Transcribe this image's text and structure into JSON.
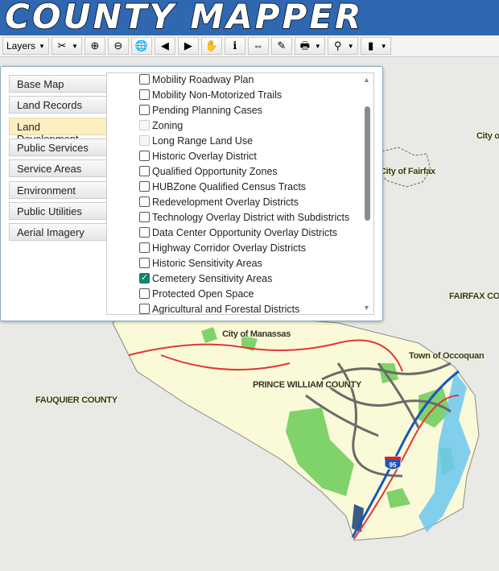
{
  "app": {
    "title": "COUNTY MAPPER"
  },
  "toolbar": {
    "layers_label": "Layers",
    "tools": [
      {
        "name": "tools-icon",
        "glyph": "✂"
      },
      {
        "name": "zoom-in-icon",
        "glyph": "⊕"
      },
      {
        "name": "zoom-out-icon",
        "glyph": "⊖"
      },
      {
        "name": "full-extent-globe-icon",
        "glyph": "🌐"
      },
      {
        "name": "previous-extent-icon",
        "glyph": "◀"
      },
      {
        "name": "next-extent-icon",
        "glyph": "▶"
      },
      {
        "name": "pan-hand-icon",
        "glyph": "✋"
      },
      {
        "name": "identify-info-icon",
        "glyph": "ℹ"
      },
      {
        "name": "measure-icon",
        "glyph": "⇔"
      },
      {
        "name": "draw-pencil-icon",
        "glyph": "✎"
      },
      {
        "name": "print-icon",
        "glyph": "🖶"
      },
      {
        "name": "find-binoculars-icon",
        "glyph": "⚲"
      },
      {
        "name": "bookmark-book-icon",
        "glyph": "▮"
      }
    ]
  },
  "layers_panel": {
    "tabs": [
      "Base Map",
      "Land Records",
      "Land Development",
      "Public Services",
      "Service Areas",
      "Environment",
      "Public Utilities",
      "Aerial Imagery"
    ],
    "active_tab": "Land Development",
    "items": [
      {
        "label": "Mobility Roadway Plan",
        "state": "unchecked"
      },
      {
        "label": "Mobility Non-Motorized Trails",
        "state": "unchecked"
      },
      {
        "label": "Pending Planning Cases",
        "state": "unchecked"
      },
      {
        "label": "Zoning",
        "state": "disabled"
      },
      {
        "label": "Long Range Land Use",
        "state": "disabled"
      },
      {
        "label": "Historic Overlay District",
        "state": "unchecked"
      },
      {
        "label": "Qualified Opportunity Zones",
        "state": "unchecked"
      },
      {
        "label": "HUBZone Qualified Census Tracts",
        "state": "unchecked"
      },
      {
        "label": "Redevelopment Overlay Districts",
        "state": "unchecked"
      },
      {
        "label": "Technology Overlay District with Subdistricts",
        "state": "unchecked"
      },
      {
        "label": "Data Center Opportunity Overlay Districts",
        "state": "unchecked"
      },
      {
        "label": "Highway Corridor Overlay Districts",
        "state": "unchecked"
      },
      {
        "label": "Historic Sensitivity Areas",
        "state": "unchecked"
      },
      {
        "label": "Cemetery Sensitivity Areas",
        "state": "checked"
      },
      {
        "label": "Protected Open Space",
        "state": "unchecked"
      },
      {
        "label": "Agricultural and Forestal Districts",
        "state": "unchecked"
      }
    ]
  },
  "map": {
    "labels": [
      "City of",
      "City of Fairfax",
      "FAIRFAX CO",
      "City of Manassas",
      "Town of Occoquan",
      "PRINCE WILLIAM COUNTY",
      "FAUQUIER COUNTY"
    ],
    "shield": "95"
  },
  "colors": {
    "header": "#2f67b1",
    "county": "#fbfad8",
    "park": "#7fd36a",
    "water": "#6cc7f0",
    "interstate": "#1a55b8"
  }
}
